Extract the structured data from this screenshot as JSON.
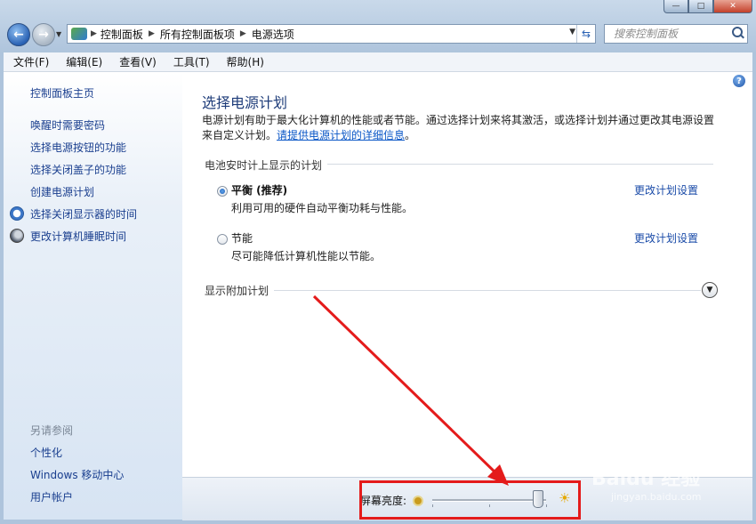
{
  "window": {
    "minimize": "—",
    "maximize": "□",
    "close": "✕"
  },
  "address": {
    "crumbs": [
      "控制面板",
      "所有控制面板项",
      "电源选项"
    ],
    "search_placeholder": "搜索控制面板"
  },
  "menu": [
    "文件(F)",
    "编辑(E)",
    "查看(V)",
    "工具(T)",
    "帮助(H)"
  ],
  "sidebar": {
    "home": "控制面板主页",
    "items": [
      "唤醒时需要密码",
      "选择电源按钮的功能",
      "选择关闭盖子的功能",
      "创建电源计划",
      "选择关闭显示器的时间",
      "更改计算机睡眠时间"
    ],
    "see_also_title": "另请参阅",
    "see_also": [
      "个性化",
      "Windows 移动中心",
      "用户帐户"
    ]
  },
  "main": {
    "title": "选择电源计划",
    "desc_text": "电源计划有助于最大化计算机的性能或者节能。通过选择计划来将其激活，或选择计划并通过更改其电源设置来自定义计划。",
    "desc_link": "请提供电源计划的详细信息",
    "desc_end": "。",
    "group_title": "电池安时计上显示的计划",
    "plans": [
      {
        "name": "平衡 (推荐)",
        "desc": "利用可用的硬件自动平衡功耗与性能。",
        "change": "更改计划设置",
        "selected": true
      },
      {
        "name": "节能",
        "desc": "尽可能降低计算机性能以节能。",
        "change": "更改计划设置",
        "selected": false
      }
    ],
    "extra_plans": "显示附加计划"
  },
  "brightness": {
    "label": "屏幕亮度:",
    "level": 0.92
  },
  "watermark": {
    "brand": "Baidu 经验",
    "url": "jingyan.baidu.com"
  },
  "annotation_color": "#e41b1b"
}
